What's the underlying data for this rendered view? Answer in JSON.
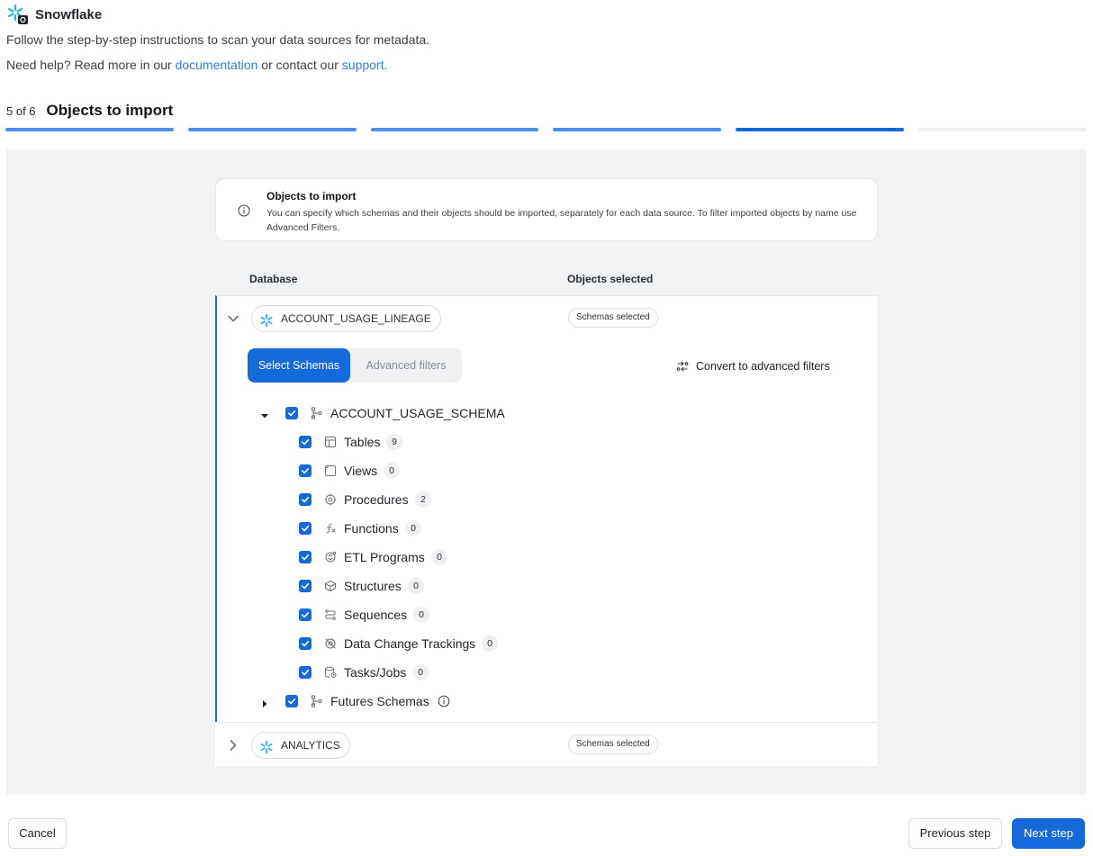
{
  "header": {
    "app_name": "Snowflake",
    "intro": "Follow the step-by-step instructions to scan your data sources for metadata.",
    "help_prefix": "Need help? Read more in our ",
    "help_doc_link": "documentation",
    "help_middle": " or contact our ",
    "help_support_link": "support."
  },
  "step": {
    "count": "5 of 6",
    "title": "Objects to import",
    "current": 5,
    "total": 6
  },
  "notice": {
    "title": "Objects to import",
    "text": "You can specify which schemas and their objects should be imported, separately for each data source. To filter imported objects by name use Advanced Filters."
  },
  "columns": {
    "database": "Database",
    "objects_selected": "Objects selected"
  },
  "databases": [
    {
      "name": "ACCOUNT_USAGE_LINEAGE",
      "badge": "Schemas selected",
      "expanded": true
    },
    {
      "name": "ANALYTICS",
      "badge": "Schemas selected",
      "expanded": false
    }
  ],
  "tabs": {
    "select_schemas": "Select Schemas",
    "advanced_filters": "Advanced filters",
    "convert": "Convert to advanced filters"
  },
  "tree": {
    "schema": {
      "label": "ACCOUNT_USAGE_SCHEMA",
      "checked": true,
      "icon": "schema-icon"
    },
    "items": [
      {
        "label": "Tables",
        "count": "9",
        "icon": "table-icon",
        "checked": true
      },
      {
        "label": "Views",
        "count": "0",
        "icon": "view-icon",
        "checked": true
      },
      {
        "label": "Procedures",
        "count": "2",
        "icon": "procedure-icon",
        "checked": true
      },
      {
        "label": "Functions",
        "count": "0",
        "icon": "function-icon",
        "checked": true
      },
      {
        "label": "ETL Programs",
        "count": "0",
        "icon": "etl-icon",
        "checked": true
      },
      {
        "label": "Structures",
        "count": "0",
        "icon": "structure-icon",
        "checked": true
      },
      {
        "label": "Sequences",
        "count": "0",
        "icon": "sequence-icon",
        "checked": true
      },
      {
        "label": "Data Change Trackings",
        "count": "0",
        "icon": "tracking-icon",
        "checked": true
      },
      {
        "label": "Tasks/Jobs",
        "count": "0",
        "icon": "task-icon",
        "checked": true
      }
    ],
    "futures": {
      "label": "Futures Schemas",
      "checked": true,
      "icon": "schema-icon"
    }
  },
  "footer": {
    "cancel": "Cancel",
    "previous": "Previous step",
    "next": "Next step"
  },
  "colors": {
    "primary": "#1469db",
    "link": "#2f7de1",
    "snowflake": "#29b5e8"
  }
}
